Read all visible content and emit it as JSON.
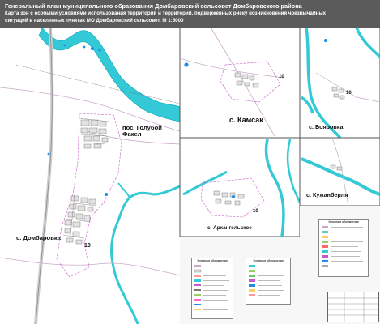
{
  "header": {
    "line1": "Генеральный план муниципального образования Домбаровский сельсовет Домбаровского района",
    "line2": "Карта зон с особыми условиями использования территорий и территорий, подверженных риску возникновения чрезвычайных",
    "line3": "ситуаций в  населенных пунктах МО Домбаровский сельсовет. М 1:5000"
  },
  "places": {
    "dombarovka": "с. Домбаровка",
    "golubof": "пос. Голубой\nФакел",
    "kamsak": "с. Камсак",
    "boyarovka": "с. Бояровка",
    "arkhangelskoe": "с. Архангельское",
    "kuzhanberlya": "с. Кужанберля"
  },
  "zone_numbers": {
    "main": "10",
    "kamsak": "10",
    "boyarovka": "10",
    "arkhangelskoe": "10"
  },
  "colors": {
    "header_bg": "#5b5b5b",
    "river": "#33c9d6",
    "river_edge": "#0aa6b8",
    "road": "#c9a8c9",
    "road_main": "#b0b0b0",
    "roads_dark": "#6e6e6e",
    "zone_line": "#c85ac8",
    "marker": "#1e8ee8",
    "panel_border": "#555555"
  },
  "legends": {
    "left_title": "Условные обозначения",
    "mid_title": "Условные обозначения",
    "right_title": "Условные обозначения"
  }
}
